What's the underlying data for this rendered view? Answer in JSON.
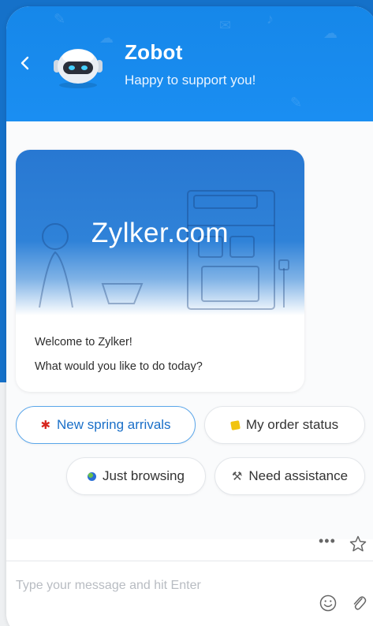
{
  "header": {
    "bot_name": "Zobot",
    "tagline": "Happy to support you!",
    "back_icon": "chevron-left-icon",
    "avatar_icon": "robot-avatar-icon"
  },
  "card": {
    "banner_title": "Zylker.com",
    "welcome": "Welcome to Zylker!",
    "prompt": "What would you like to do today?"
  },
  "chips": [
    {
      "label": "New spring arrivals",
      "icon": "red-figure-icon",
      "active": true
    },
    {
      "label": "My order status",
      "icon": "yellow-box-icon",
      "active": false
    },
    {
      "label": "Just browsing",
      "icon": "globe-icon",
      "active": false
    },
    {
      "label": "Need assistance",
      "icon": "tools-icon",
      "active": false
    }
  ],
  "toolbar": {
    "more_icon": "more-dots-icon",
    "star_icon": "star-outline-icon"
  },
  "composer": {
    "placeholder": "Type your message and hit Enter",
    "value": "",
    "emoji_icon": "emoji-icon",
    "attach_icon": "paperclip-icon"
  },
  "colors": {
    "header_blue": "#1a8ef2",
    "backdrop_blue": "#1571c9",
    "chip_active_border": "#5aa6ea",
    "chip_active_text": "#1a6fc8"
  }
}
